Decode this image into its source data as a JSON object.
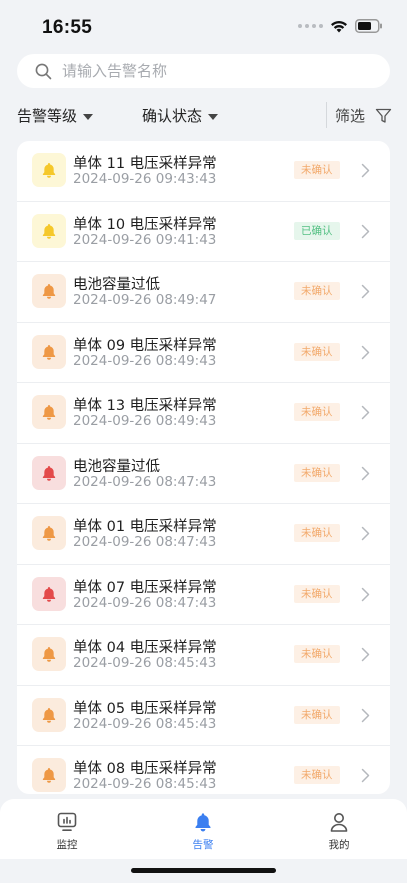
{
  "status_bar": {
    "time": "16:55"
  },
  "search": {
    "placeholder": "请输入告警名称"
  },
  "filters": {
    "level_label": "告警等级",
    "confirm_label": "确认状态",
    "screen_label": "筛选"
  },
  "colors": {
    "yellow_bg": "#fdf7d6",
    "yellow_icon": "#f5c82b",
    "orange_bg": "#fbebdd",
    "orange_icon": "#ee9845",
    "red_bg": "#f8dede",
    "red_icon": "#e34a4a",
    "unconfirmed_bg": "#fdf0e5",
    "unconfirmed_text": "#f2a96b",
    "confirmed_bg": "#e6f6ec",
    "confirmed_text": "#54c083",
    "accent": "#3b7ff0"
  },
  "alarms": [
    {
      "title": "单体 11 电压采样异常",
      "time": "2024-09-26 09:43:43",
      "level": "yellow",
      "status": "未确认",
      "confirmed": false,
      "icon": "bell-icon"
    },
    {
      "title": "单体 10 电压采样异常",
      "time": "2024-09-26 09:41:43",
      "level": "yellow",
      "status": "已确认",
      "confirmed": true,
      "icon": "bell-icon"
    },
    {
      "title": "电池容量过低",
      "time": "2024-09-26 08:49:47",
      "level": "orange",
      "status": "未确认",
      "confirmed": false,
      "icon": "bell-icon"
    },
    {
      "title": "单体 09 电压采样异常",
      "time": "2024-09-26 08:49:43",
      "level": "orange",
      "status": "未确认",
      "confirmed": false,
      "icon": "bell-icon"
    },
    {
      "title": "单体 13 电压采样异常",
      "time": "2024-09-26 08:49:43",
      "level": "orange",
      "status": "未确认",
      "confirmed": false,
      "icon": "bell-icon"
    },
    {
      "title": "电池容量过低",
      "time": "2024-09-26 08:47:43",
      "level": "red",
      "status": "未确认",
      "confirmed": false,
      "icon": "bell-icon"
    },
    {
      "title": "单体 01 电压采样异常",
      "time": "2024-09-26 08:47:43",
      "level": "orange",
      "status": "未确认",
      "confirmed": false,
      "icon": "bell-icon"
    },
    {
      "title": "单体 07 电压采样异常",
      "time": "2024-09-26 08:47:43",
      "level": "red",
      "status": "未确认",
      "confirmed": false,
      "icon": "bell-icon"
    },
    {
      "title": "单体 04 电压采样异常",
      "time": "2024-09-26 08:45:43",
      "level": "orange",
      "status": "未确认",
      "confirmed": false,
      "icon": "bell-icon"
    },
    {
      "title": "单体 05 电压采样异常",
      "time": "2024-09-26 08:45:43",
      "level": "orange",
      "status": "未确认",
      "confirmed": false,
      "icon": "bell-icon"
    },
    {
      "title": "单体 08 电压采样异常",
      "time": "2024-09-26 08:45:43",
      "level": "orange",
      "status": "未确认",
      "confirmed": false,
      "icon": "bell-icon"
    }
  ],
  "tabbar": {
    "items": [
      {
        "label": "监控",
        "icon": "monitor-icon",
        "active": false
      },
      {
        "label": "告警",
        "icon": "bell-icon",
        "active": true
      },
      {
        "label": "我的",
        "icon": "user-icon",
        "active": false
      }
    ]
  }
}
